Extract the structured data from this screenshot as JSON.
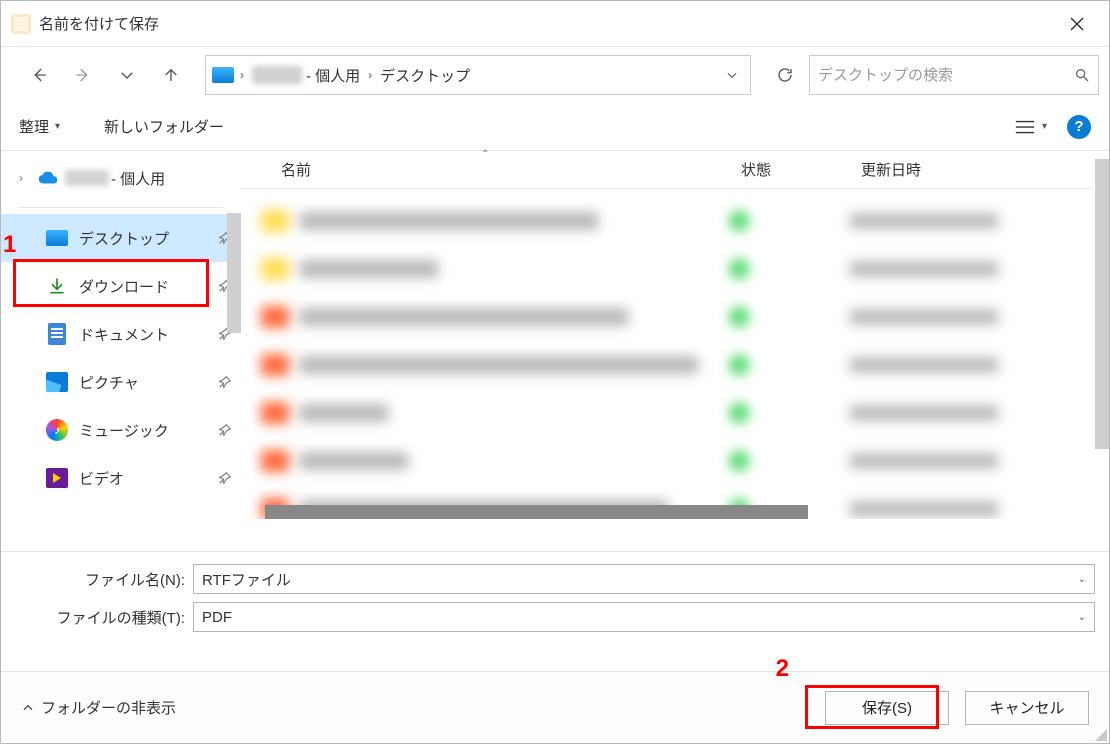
{
  "window": {
    "title": "名前を付けて保存"
  },
  "breadcrumb": {
    "personal_suffix": " - 個人用",
    "dest": "デスクトップ"
  },
  "search": {
    "placeholder": "デスクトップの検索"
  },
  "toolbar": {
    "organize": "整理",
    "new_folder": "新しいフォルダー"
  },
  "headers": {
    "name": "名前",
    "status": "状態",
    "modified": "更新日時"
  },
  "sidebar": {
    "top_suffix": " - 個人用",
    "items": [
      {
        "label": "デスクトップ"
      },
      {
        "label": "ダウンロード"
      },
      {
        "label": "ドキュメント"
      },
      {
        "label": "ピクチャ"
      },
      {
        "label": "ミュージック"
      },
      {
        "label": "ビデオ"
      }
    ]
  },
  "form": {
    "filename_label": "ファイル名(N):",
    "filename_value": "RTFファイル",
    "filetype_label": "ファイルの種類(T):",
    "filetype_value": "PDF"
  },
  "footer": {
    "fold_toggle": "フォルダーの非表示",
    "save": "保存(S)",
    "cancel": "キャンセル"
  },
  "annotations": {
    "one": "1",
    "two": "2"
  }
}
